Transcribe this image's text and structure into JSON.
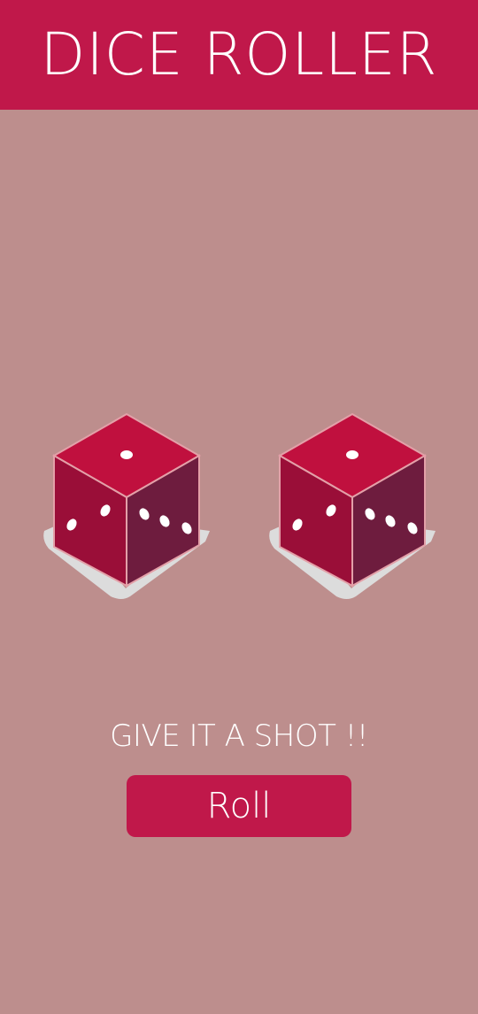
{
  "app_bar": {
    "title": "DICE ROLLER",
    "color": "#c0184a"
  },
  "background_color": "#bd8e8d",
  "dice": [
    {
      "name": "die-1",
      "icon": "dice-icon"
    },
    {
      "name": "die-2",
      "icon": "dice-icon"
    }
  ],
  "tagline": "GIVE IT A SHOT !!",
  "roll_button": {
    "label": "Roll",
    "color": "#c0184a"
  },
  "die_colors": {
    "top": "#c0103e",
    "left": "#9a0e38",
    "right": "#6e1c3e",
    "edge": "#e3a0a8",
    "shadow": "#dcdcdc",
    "pip": "#ffffff"
  }
}
